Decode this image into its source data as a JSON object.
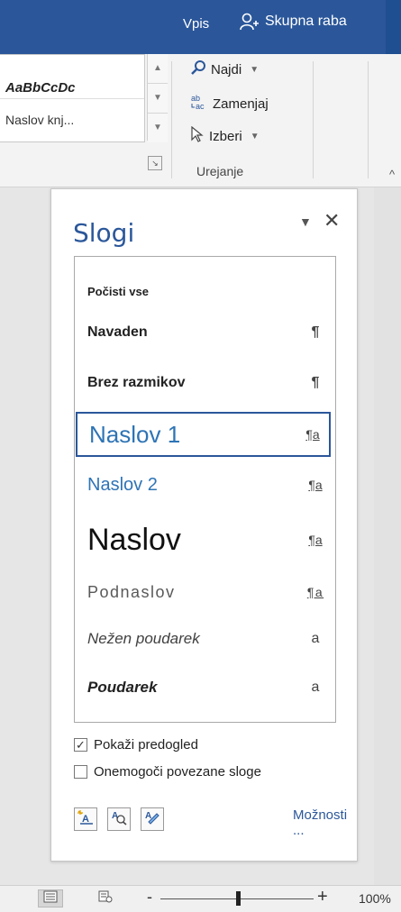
{
  "titlebar": {
    "tab_vpis": "Vpis",
    "share_label": "Skupna raba",
    "color": "#2b579a"
  },
  "ribbon": {
    "gallery": {
      "row1": "AaBbCcDc",
      "row2": "Naslov knj..."
    },
    "editing": {
      "find": "Najdi",
      "replace": "Zamenjaj",
      "select": "Izberi",
      "group_label": "Urejanje"
    }
  },
  "pane": {
    "title": "Slogi",
    "styles": [
      {
        "label": "Počisti vse",
        "mark": ""
      },
      {
        "label": "Navaden",
        "mark": "¶"
      },
      {
        "label": "Brez razmikov",
        "mark": "¶"
      },
      {
        "label": "Naslov 1",
        "mark": "¶a"
      },
      {
        "label": "Naslov 2",
        "mark": "¶a"
      },
      {
        "label": "Naslov",
        "mark": "¶a"
      },
      {
        "label": "Podnaslov",
        "mark": "¶a"
      },
      {
        "label": "Nežen poudarek",
        "mark": "a"
      },
      {
        "label": "Poudarek",
        "mark": "a"
      }
    ],
    "selected_style": "Naslov 1",
    "show_preview": {
      "label": "Pokaži predogled",
      "checked": true
    },
    "disable_linked": {
      "label": "Onemogoči povezane sloge",
      "checked": false
    },
    "options_link": "Možnosti ..."
  },
  "statusbar": {
    "zoom_level": "100%",
    "zoom_minus": "-",
    "zoom_plus": "+"
  }
}
